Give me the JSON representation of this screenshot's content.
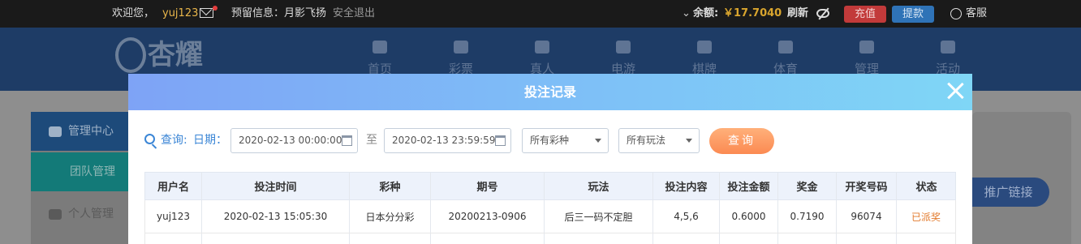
{
  "topbar": {
    "welcome": "欢迎您，",
    "username": "yuj123",
    "reserved_info": "预留信息：月影飞扬",
    "logout": "安全退出",
    "balance_label": "余额:",
    "balance": "￥17.7040",
    "refresh": "刷新",
    "recharge": "充值",
    "withdraw": "提款",
    "service": "客服"
  },
  "nav": {
    "items": [
      {
        "label": "首页",
        "icon": "home-icon"
      },
      {
        "label": "彩票",
        "icon": "lottery-icon"
      },
      {
        "label": "真人",
        "icon": "live-icon"
      },
      {
        "label": "电游",
        "icon": "slot-icon"
      },
      {
        "label": "棋牌",
        "icon": "cards-icon"
      },
      {
        "label": "体育",
        "icon": "trophy-icon"
      },
      {
        "label": "管理",
        "icon": "users-icon"
      },
      {
        "label": "活动",
        "icon": "gift-icon"
      }
    ],
    "logo_text": "杏耀"
  },
  "sidebar": {
    "manage_center": "管理中心",
    "team_manage": "团队管理",
    "personal_manage": "个人管理"
  },
  "promo_button": "推广链接",
  "modal": {
    "title": "投注记录",
    "query_label": "查询:",
    "date_label": "日期：",
    "date_from": "2020-02-13 00:00:00",
    "to_label": "至",
    "date_to": "2020-02-13 23:59:59",
    "lottery_select": "所有彩种",
    "play_select": "所有玩法",
    "query_button": "查询",
    "columns": [
      "用户名",
      "投注时间",
      "彩种",
      "期号",
      "玩法",
      "投注内容",
      "投注金额",
      "奖金",
      "开奖号码",
      "状态"
    ],
    "rows": [
      [
        "yuj123",
        "2020-02-13 15:05:30",
        "日本分分彩",
        "20200213-0906",
        "后三一码不定胆",
        "4,5,6",
        "0.6000",
        "0.7190",
        "96074",
        "已派奖"
      ]
    ]
  },
  "colors": {
    "accent_blue": "#3b86d6",
    "query_button": "#fb8a52",
    "status_paid": "#e2792b",
    "recharge": "#c23a3a",
    "withdraw": "#2f73b7"
  }
}
